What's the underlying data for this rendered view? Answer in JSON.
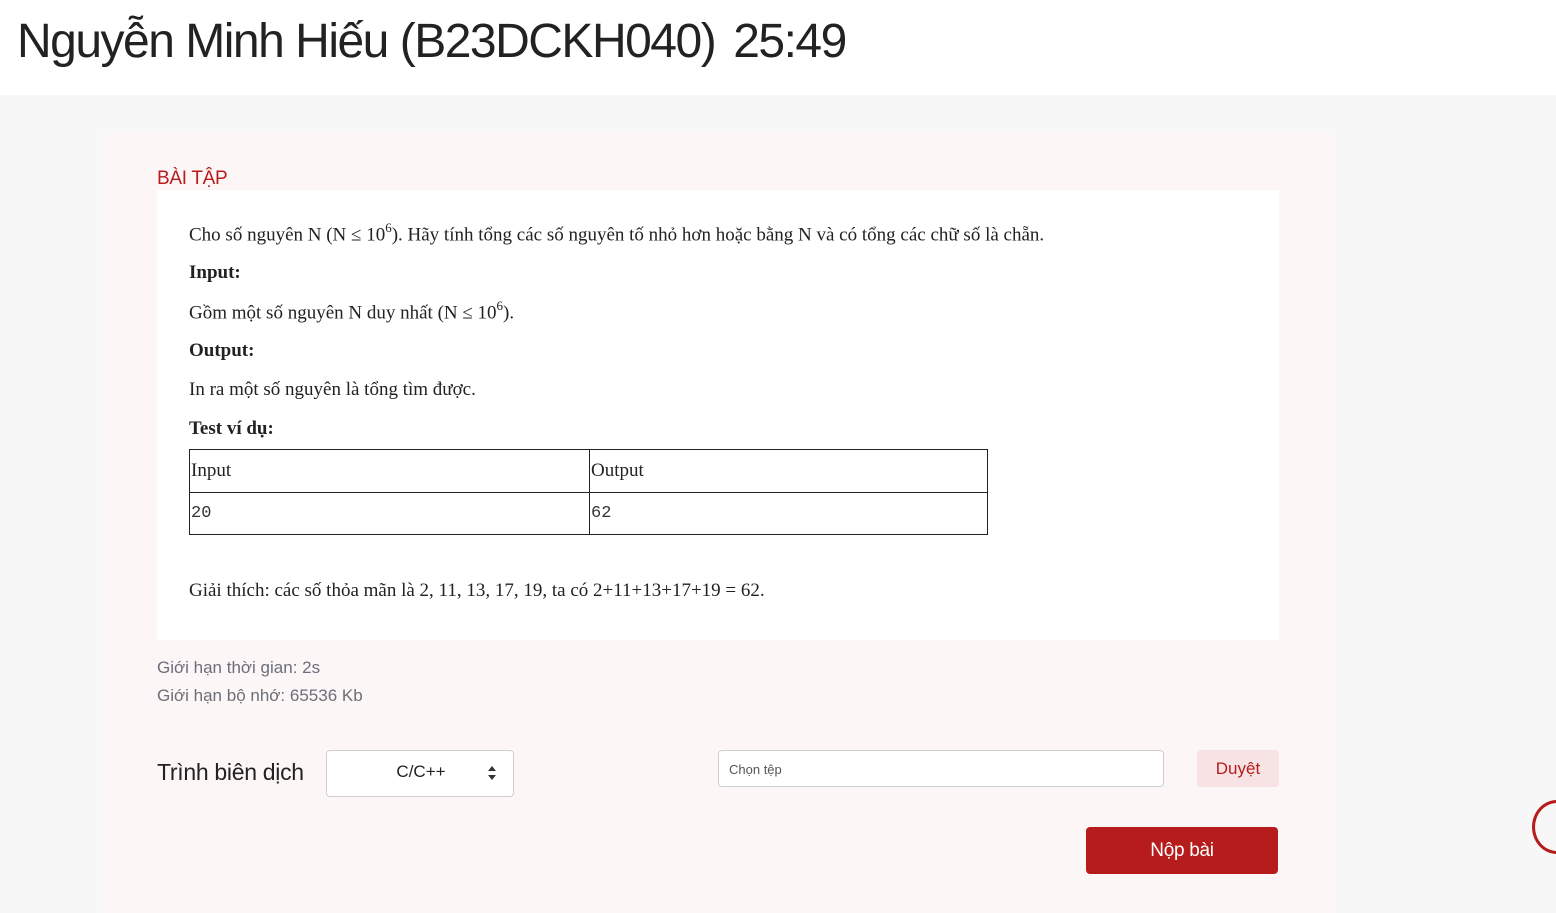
{
  "header": {
    "student": "Nguyễn Minh Hiếu (B23DCKH040)",
    "timer": "25:49"
  },
  "problem": {
    "section_label": "BÀI TẬP",
    "statement_pre": "Cho số nguyên N (N ≤ 10",
    "statement_sup": "6",
    "statement_post": "). Hãy tính tổng các số nguyên tố nhỏ hơn hoặc bằng N và có tổng các chữ số là chẵn.",
    "input_heading": "Input:",
    "input_pre": "Gồm một số nguyên N duy nhất (N ≤ 10",
    "input_sup": "6",
    "input_post": ").",
    "output_heading": "Output:",
    "output_text": "In ra một số nguyên là tổng tìm được.",
    "example_heading": "Test ví dụ:",
    "example_table": {
      "headers": [
        "Input",
        "Output"
      ],
      "rows": [
        [
          "20",
          "62"
        ]
      ]
    },
    "explanation": "Giải thích: các số thỏa mãn là 2, 11, 13, 17, 19, ta có 2+11+13+17+19 = 62."
  },
  "limits": {
    "time": "Giới hạn thời gian: 2s",
    "memory": "Giới hạn bộ nhớ: 65536 Kb"
  },
  "submission": {
    "compiler_label": "Trình biên dịch",
    "compiler_selected": "C/C++",
    "file_placeholder": "Chọn tệp",
    "browse_label": "Duyệt",
    "submit_label": "Nộp bài"
  },
  "colors": {
    "accent": "#b71c1c",
    "browse_bg": "#f7e3e3",
    "panel_bg": "#fcf6f6",
    "page_bg": "#f7f7f7",
    "muted_text": "#6b6f7a"
  }
}
